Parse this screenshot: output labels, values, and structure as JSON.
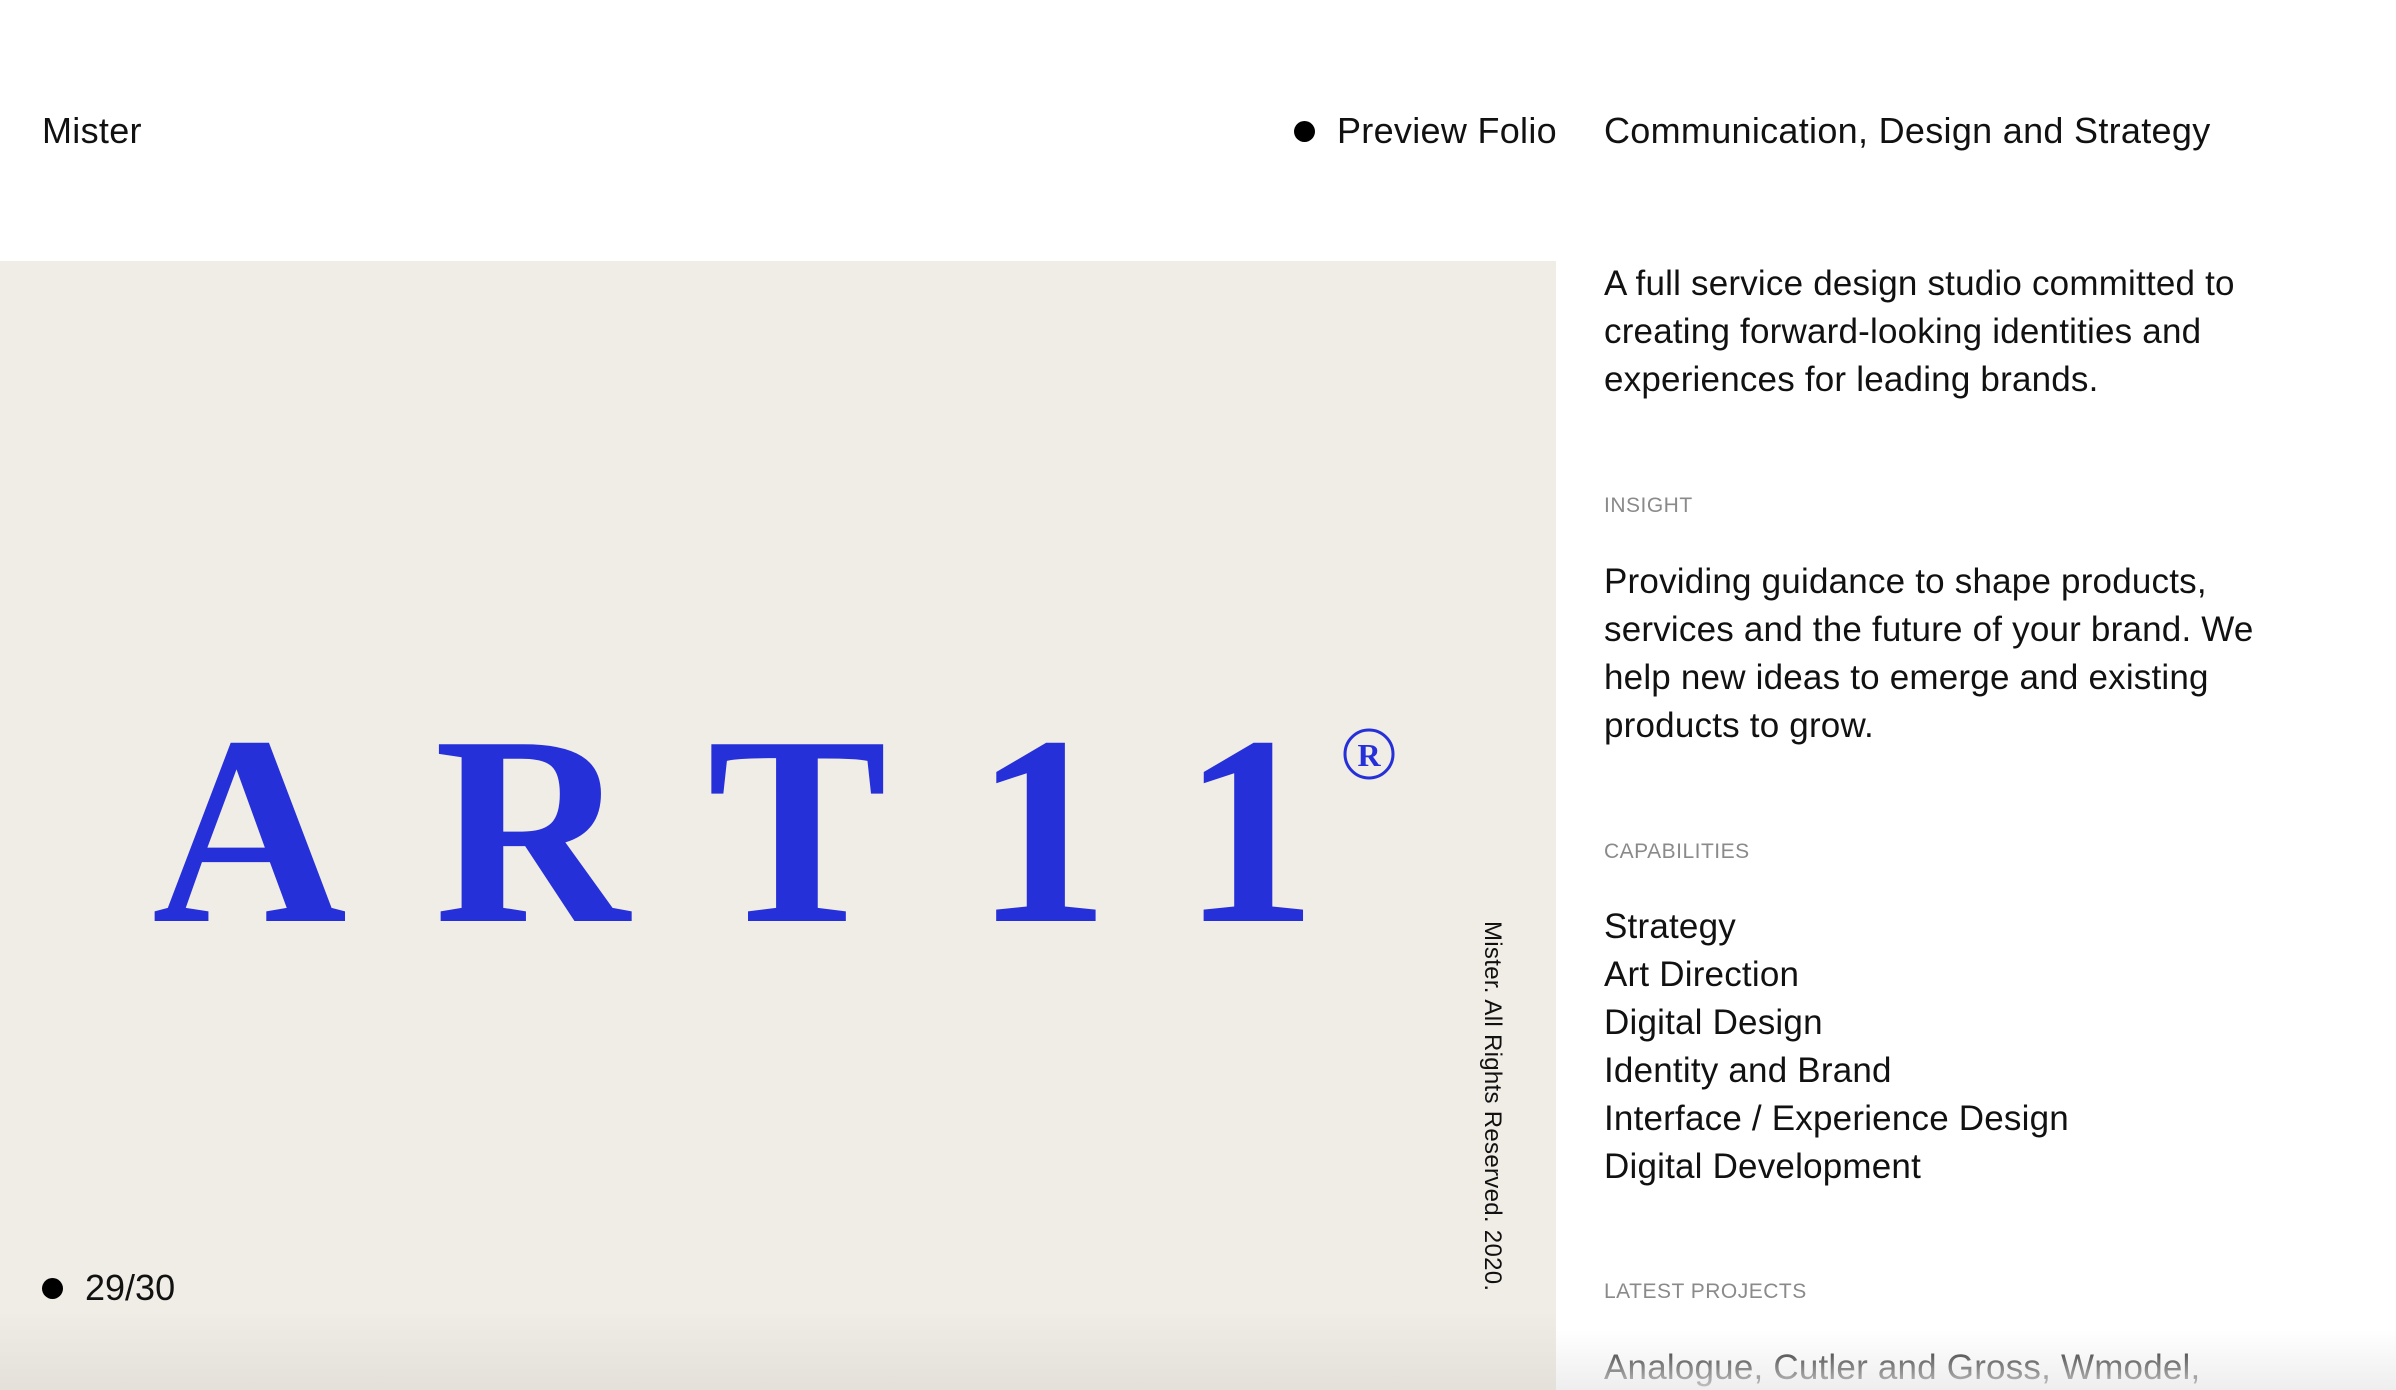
{
  "header": {
    "brand": "Mister",
    "preview_link": "Preview Folio",
    "tagline": "Communication, Design and Strategy"
  },
  "showcase": {
    "logo_text": "ART11",
    "logo_mark": "R",
    "copyright_vertical": "Mister. All Rights Reserved. 2020.",
    "counter": "29/30"
  },
  "info": {
    "about": "A full service design studio committed to creating forward-looking identities and experiences for leading brands.",
    "insight": {
      "label": "INSIGHT",
      "text": "Providing guidance to shape products, services and the future of your brand. We help new ideas to emerge and existing products to grow."
    },
    "capabilities": {
      "label": "CAPABILITIES",
      "items": [
        "Strategy",
        "Art Direction",
        "Digital Design",
        "Identity and Brand",
        "Interface / Experience Design",
        "Digital Development"
      ]
    },
    "projects": {
      "label": "LATEST PROJECTS",
      "text": "Analogue, Cutler and Gross, Wmodel,"
    }
  },
  "colors": {
    "accent": "#2630d8",
    "panel_bg": "#f0ece6",
    "label_gray": "#8a8a8a"
  },
  "icons": {
    "bullet": "dot-icon"
  }
}
